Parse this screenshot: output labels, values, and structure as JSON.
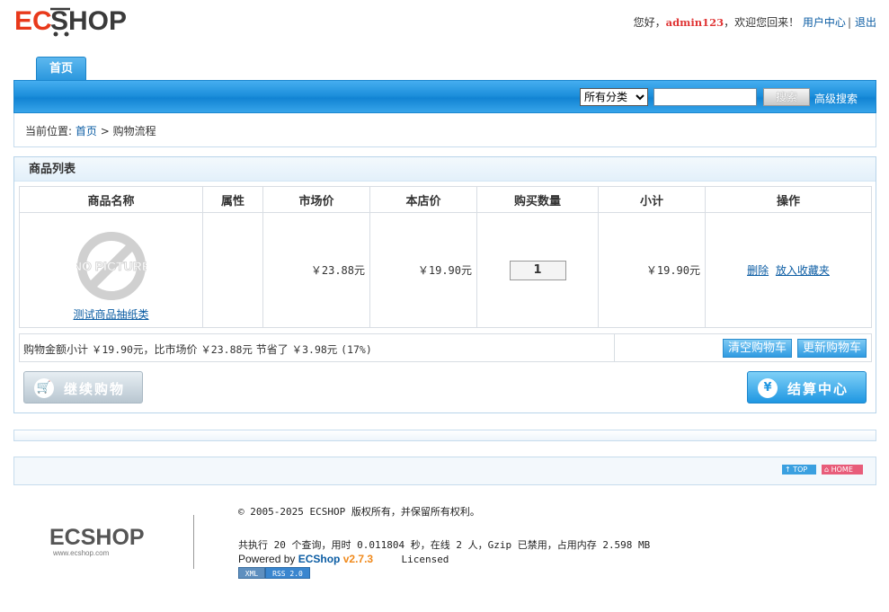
{
  "header": {
    "greeting": "您好，",
    "username": "admin123",
    "welcome": "，欢迎您回来！",
    "user_center": "用户中心",
    "separator": "|",
    "logout": "退出"
  },
  "nav": {
    "home_tab": "首页"
  },
  "search": {
    "category_selected": "所有分类",
    "keyword_value": "",
    "button": "搜索",
    "advanced": "高级搜索"
  },
  "breadcrumb": {
    "prefix": "当前位置:",
    "home": "首页",
    "arrow": ">",
    "current": "购物流程"
  },
  "cart": {
    "title": "商品列表",
    "columns": [
      "商品名称",
      "属性",
      "市场价",
      "本店价",
      "购买数量",
      "小计",
      "操作"
    ],
    "item": {
      "no_picture": "NO PICTURE",
      "name": "测试商品抽纸类",
      "attr": "",
      "market_price": "￥23.88元",
      "shop_price": "￥19.90元",
      "quantity": "1",
      "subtotal": "￥19.90元",
      "delete": "删除",
      "favorite": "放入收藏夹"
    },
    "summary": {
      "label1": "购物金额小计",
      "total": "￥19.90元",
      "label2": "，比市场价",
      "market": "￥23.88元",
      "label3": "节省了",
      "saved": "￥3.98元",
      "percent": "(17%)"
    },
    "clear_button": "清空购物车",
    "update_button": "更新购物车",
    "continue_button": "继续购物",
    "checkout_button": "结算中心"
  },
  "footbar": {
    "top": "↑ TOP",
    "home": "⌂ HOME"
  },
  "footer": {
    "logo_url": "www.ecshop.com",
    "copyright": "© 2005-2025 ECSHOP 版权所有，并保留所有权利。",
    "stats": "共执行 20 个查询，用时 0.011804 秒，在线 2 人，Gzip 已禁用，占用内存 2.598 MB",
    "powered_by": "Powered by",
    "brand": "ECShop",
    "version": "v2.7.3",
    "licensed": "Licensed",
    "xml_badge": "XML",
    "rss_badge": "RSS 2.0"
  },
  "colors": {
    "nav_blue": "#1e90dc",
    "link_blue": "#0b5ca3",
    "username_red": "#e03636",
    "logo_red": "#e8391b",
    "version_orange": "#f08a1c"
  }
}
